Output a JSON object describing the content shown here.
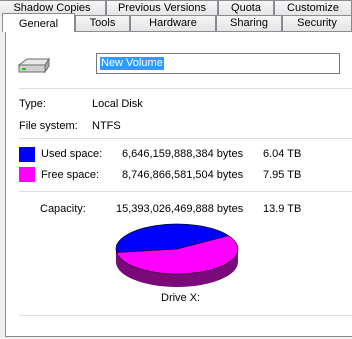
{
  "tabs_back": [
    "Shadow Copies",
    "Previous Versions",
    "Quota",
    "Customize"
  ],
  "tabs_front": [
    "General",
    "Tools",
    "Hardware",
    "Sharing",
    "Security"
  ],
  "volume_name": "New Volume",
  "type": {
    "label": "Type:",
    "value": "Local Disk"
  },
  "file_system": {
    "label": "File system:",
    "value": "NTFS"
  },
  "used": {
    "label": "Used space:",
    "bytes": "6,646,159,888,384 bytes",
    "size": "6.04 TB",
    "color": "#0000ff"
  },
  "free": {
    "label": "Free space:",
    "bytes": "8,746,866,581,504 bytes",
    "size": "7.95 TB",
    "color": "#ff00ff"
  },
  "capacity": {
    "label": "Capacity:",
    "bytes": "15,393,026,469,888 bytes",
    "size": "13.9 TB"
  },
  "drive_label": "Drive X:",
  "used_fraction": 0.432,
  "icons": {
    "drive": "hard-drive-icon"
  }
}
